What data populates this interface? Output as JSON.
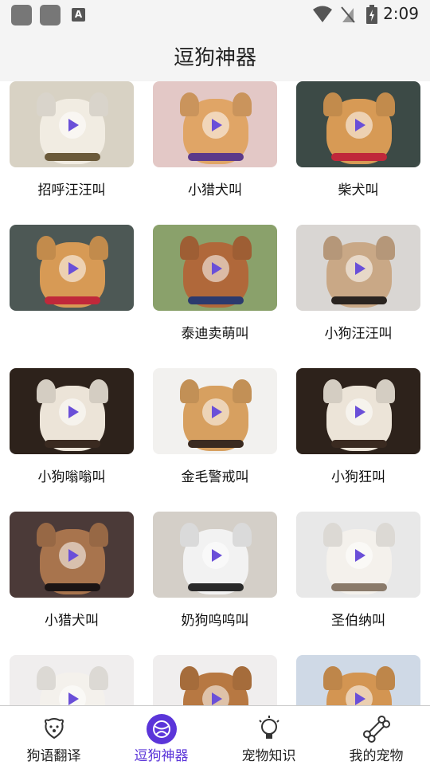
{
  "status_bar": {
    "time": "2:09"
  },
  "header": {
    "title": "逗狗神器"
  },
  "cards": [
    {
      "label": "招呼汪汪叫",
      "bg": "#d8d2c4",
      "dog": "#f1ece2",
      "accent": "#6b5a3a"
    },
    {
      "label": "小猎犬叫",
      "bg": "#e3c8c6",
      "dog": "#e0a566",
      "accent": "#5c3a8a"
    },
    {
      "label": "柴犬叫",
      "bg": "#3c4a46",
      "dog": "#d79a55",
      "accent": "#c0283a"
    },
    {
      "label": "",
      "bg": "#4d5855",
      "dog": "#d79a55",
      "accent": "#c0283a"
    },
    {
      "label": "泰迪卖萌叫",
      "bg": "#8aa16b",
      "dog": "#b0683a",
      "accent": "#2b3a6e"
    },
    {
      "label": "小狗汪汪叫",
      "bg": "#d9d6d3",
      "dog": "#c9a886",
      "accent": "#2a2420"
    },
    {
      "label": "小狗嗡嗡叫",
      "bg": "#2d221b",
      "dog": "#ece4d8",
      "accent": "#3a2a20"
    },
    {
      "label": "金毛警戒叫",
      "bg": "#f2f1ef",
      "dog": "#d7a060",
      "accent": "#3a2a20"
    },
    {
      "label": "小狗狂叫",
      "bg": "#2d221b",
      "dog": "#ece4d8",
      "accent": "#3a2a20"
    },
    {
      "label": "小猎犬叫",
      "bg": "#4b3a38",
      "dog": "#a8744d",
      "accent": "#1b1414"
    },
    {
      "label": "奶狗呜呜叫",
      "bg": "#d4cfc8",
      "dog": "#f2f2f2",
      "accent": "#2a2a2a"
    },
    {
      "label": "圣伯纳叫",
      "bg": "#e8e8e8",
      "dog": "#f4f1ec",
      "accent": "#8a7a6a"
    },
    {
      "label": "",
      "bg": "#f0eeee",
      "dog": "#f4f1ec",
      "accent": "#8a7a6a"
    },
    {
      "label": "",
      "bg": "#f0eeee",
      "dog": "#b77842",
      "accent": "#3a2a20"
    },
    {
      "label": "",
      "bg": "#cfd9e6",
      "dog": "#d39552",
      "accent": "#3a2a20"
    }
  ],
  "nav": {
    "items": [
      {
        "label": "狗语翻译",
        "icon": "dog-face-icon"
      },
      {
        "label": "逗狗神器",
        "icon": "ball-icon"
      },
      {
        "label": "宠物知识",
        "icon": "lightbulb-icon"
      },
      {
        "label": "我的宠物",
        "icon": "bone-icon"
      }
    ],
    "active_index": 1,
    "active_color": "#5b35d9"
  }
}
